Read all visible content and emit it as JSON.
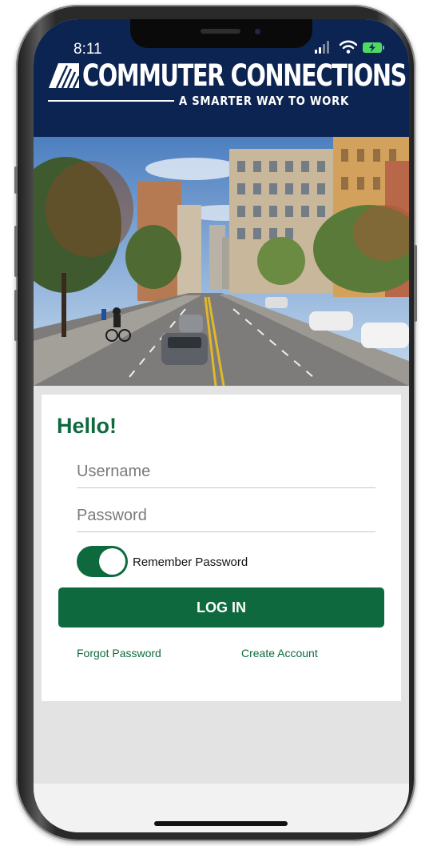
{
  "status_bar": {
    "time": "8:11"
  },
  "header": {
    "brand": "COMMUTER CONNECTIONS",
    "registered_mark": "®",
    "tagline": "A SMARTER WAY TO WORK"
  },
  "login": {
    "greeting": "Hello!",
    "username_placeholder": "Username",
    "password_placeholder": "Password",
    "remember_label": "Remember Password",
    "remember_enabled": true,
    "login_button": "LOG IN",
    "forgot_password": "Forgot Password",
    "create_account": "Create Account"
  },
  "colors": {
    "header_bg": "#0c2451",
    "brand_green": "#0e6a3e",
    "battery_green": "#4cd964"
  },
  "icons": [
    "signal-icon",
    "wifi-icon",
    "battery-charging-icon",
    "logo-mark-icon"
  ]
}
